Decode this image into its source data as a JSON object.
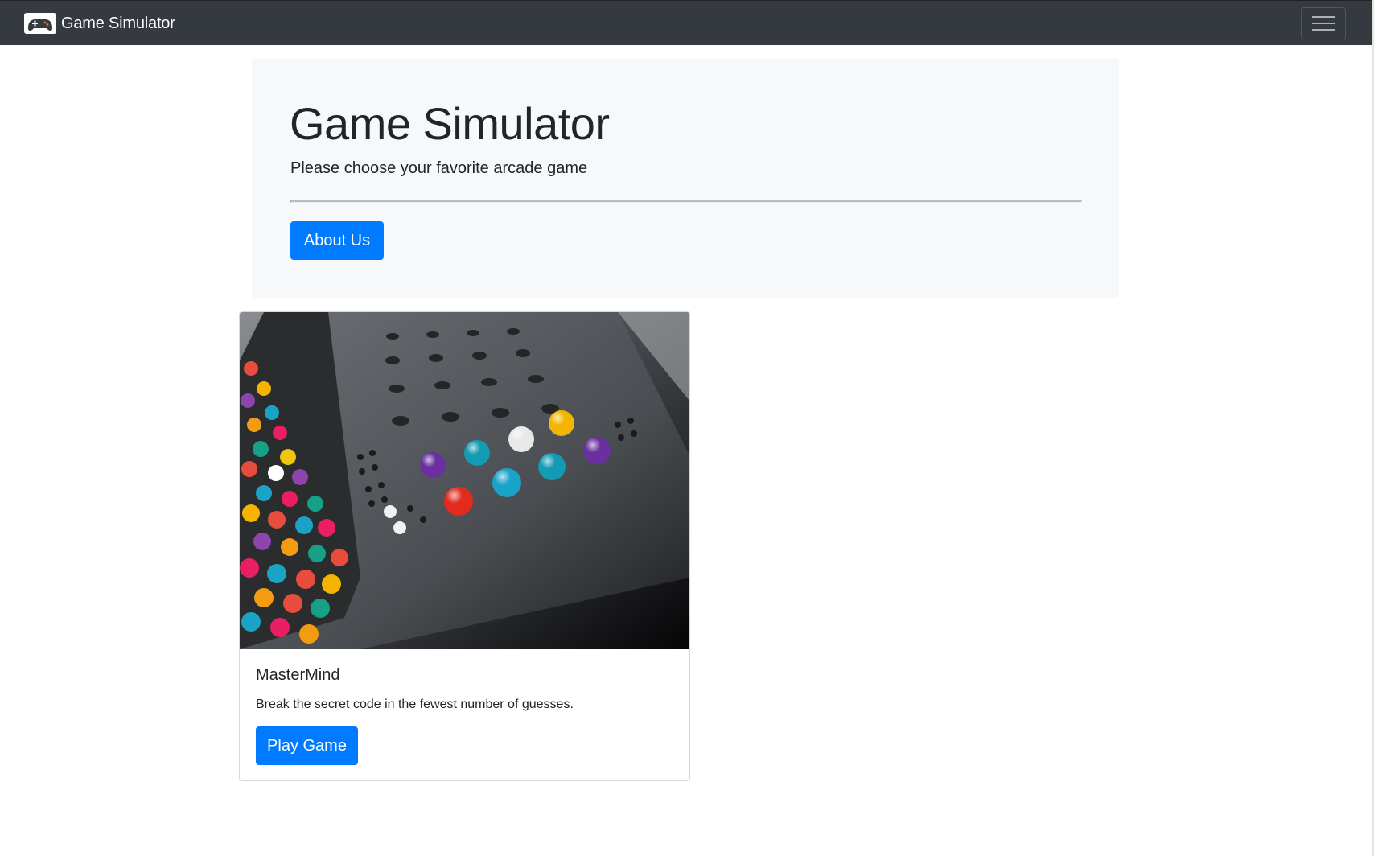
{
  "navbar": {
    "brand": "Game Simulator",
    "brand_icon": "gamepad-icon",
    "menu_icon": "hamburger-menu-icon",
    "background": "#343a40"
  },
  "jumbotron": {
    "title": "Game Simulator",
    "lead": "Please choose your favorite arcade game",
    "about_button": "About Us"
  },
  "games": [
    {
      "name": "MasterMind",
      "description": "Break the secret code in the fewest number of guesses.",
      "button": "Play Game",
      "image": "mastermind-board-photo"
    }
  ],
  "colors": {
    "primary": "#007bff",
    "jumbotron_bg": "#f7f8f9"
  }
}
